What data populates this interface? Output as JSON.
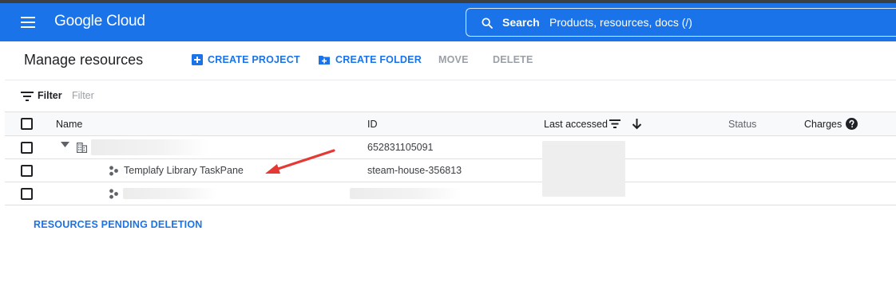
{
  "header": {
    "logo": "Google Cloud",
    "search_label": "Search",
    "search_placeholder": "Products, resources, docs (/)"
  },
  "toolbar": {
    "title": "Manage resources",
    "create_project": "CREATE PROJECT",
    "create_folder": "CREATE FOLDER",
    "move": "MOVE",
    "delete": "DELETE"
  },
  "filter": {
    "label": "Filter",
    "placeholder": "Filter"
  },
  "table": {
    "columns": {
      "name": "Name",
      "id": "ID",
      "last_accessed": "Last accessed",
      "status": "Status",
      "charges": "Charges"
    },
    "rows": [
      {
        "name": "",
        "id": "652831105091"
      },
      {
        "name": "Templafy Library TaskPane",
        "id": "steam-house-356813"
      },
      {
        "name": "",
        "id": ""
      }
    ]
  },
  "pending_link": "RESOURCES PENDING DELETION",
  "colors": {
    "brand_blue": "#1a73e8",
    "annotation_arrow": "#e53935"
  },
  "icons": {
    "menu": "hamburger-menu-icon",
    "search": "search-icon",
    "add_box": "add-box-icon",
    "create_folder": "create-new-folder-icon",
    "filter": "filter-list-icon",
    "sort": "sort-icon",
    "arrow_down": "arrow-downward-icon",
    "help": "help-icon",
    "expand": "triangle-down-icon",
    "organization": "domain-icon",
    "project": "project-icon"
  }
}
